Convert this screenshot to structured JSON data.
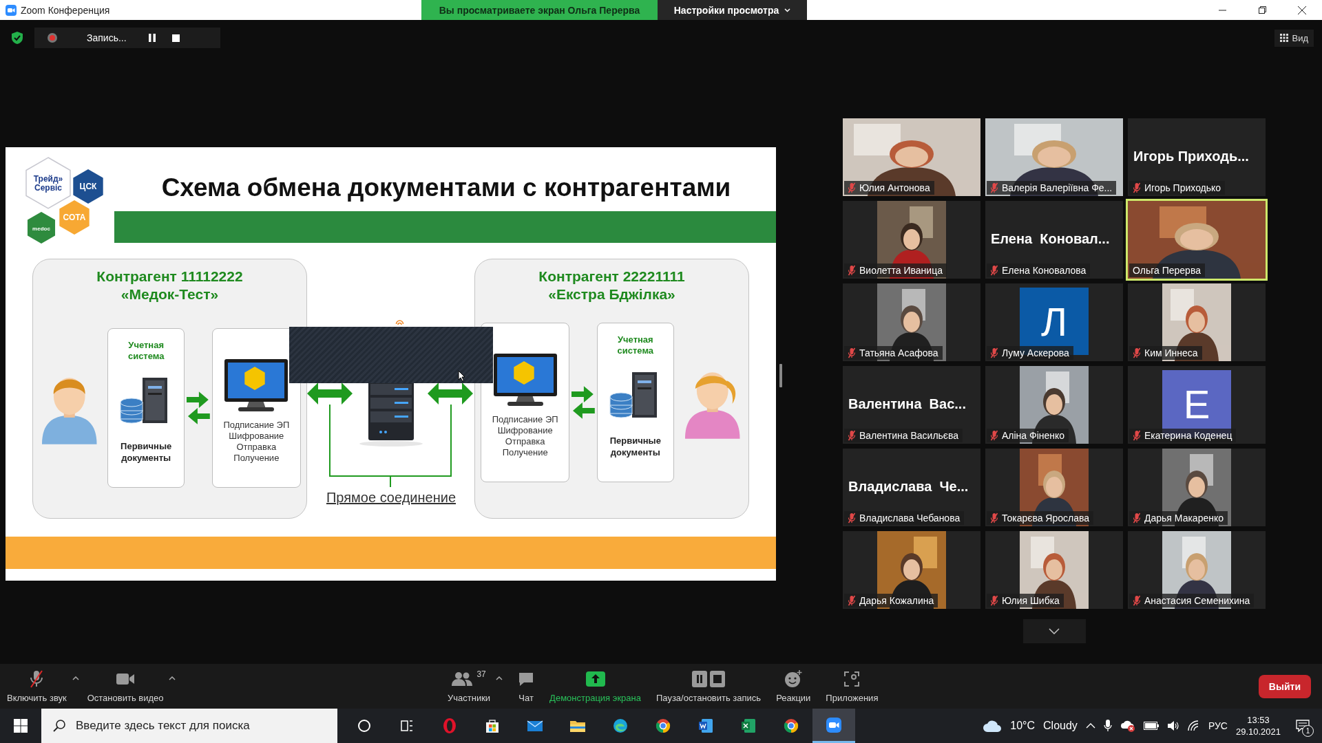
{
  "window": {
    "title": "Zoom Конференция"
  },
  "share_banner": {
    "text": "Вы просматриваете экран Ольга Перерва",
    "menu": "Настройки просмотра"
  },
  "recording": {
    "label": "Запись..."
  },
  "view_button": "Вид",
  "slide": {
    "title": "Схема обмена документами с контрагентами",
    "logos": [
      {
        "kind": "sota",
        "lines": [
          "СОТА"
        ]
      },
      {
        "kind": "trade",
        "lines": [
          "Трейд»",
          "Сервіс"
        ]
      },
      {
        "kind": "csk",
        "lines": [
          "ЦСК"
        ]
      },
      {
        "kind": "medoc",
        "lines": [
          "medoc"
        ]
      }
    ],
    "parties": [
      {
        "title": "Контрагент 11112222",
        "subtitle": "«Медок-Тест»",
        "system_label": "Учетная система",
        "docs_label": "Первичные документы",
        "operations": [
          "Подписание ЭП",
          "Шифрование",
          "Отправка",
          "Получение"
        ],
        "person": {
          "kind": "male"
        }
      },
      {
        "title": "Контрагент 22221111",
        "subtitle": "«Екстра Бджілка»",
        "system_label": "Учетная система",
        "docs_label": "Первичные документы",
        "operations": [
          "Подписание ЭП",
          "Шифрование",
          "Отправка",
          "Получение"
        ],
        "person": {
          "kind": "female"
        }
      }
    ],
    "connection_label": "Прямое соединение"
  },
  "participants": [
    {
      "name": "Юлия Антонова",
      "kind": "video",
      "muted": true,
      "active": false
    },
    {
      "name": "Валерія Валеріївна Фе...",
      "kind": "video",
      "muted": true,
      "active": false
    },
    {
      "name": "Игорь Приходько",
      "kind": "name",
      "display": "Игорь Приходь...",
      "muted": true,
      "active": false
    },
    {
      "name": "Виолетта Иваница",
      "muted": true,
      "active": false
    },
    {
      "name": "Елена Коновалова",
      "kind": "name",
      "display": "Елена  Коновал...",
      "muted": true,
      "active": false
    },
    {
      "name": "Ольга Перерва",
      "kind": "video",
      "muted": false,
      "active": true
    },
    {
      "name": "Татьяна Асафова",
      "muted": true,
      "active": false
    },
    {
      "name": "Луму Аскерова",
      "kind": "avatar",
      "letter": "Л",
      "color": "#0b5aa6",
      "muted": true,
      "active": false
    },
    {
      "name": "Ким Иннеса",
      "muted": true,
      "active": false
    },
    {
      "name": "Валентина Васильєва",
      "kind": "name",
      "display": "Валентина  Вас...",
      "muted": true,
      "active": false
    },
    {
      "name": "Аліна Фіненко",
      "muted": true,
      "active": false
    },
    {
      "name": "Екатерина Коденец",
      "kind": "avatar",
      "letter": "Е",
      "color": "#5b67c2",
      "muted": true,
      "active": false
    },
    {
      "name": "Владислава Чебанова",
      "kind": "name",
      "display": "Владислава  Че...",
      "muted": true,
      "active": false
    },
    {
      "name": "Токарєва Ярослава",
      "muted": true,
      "active": false
    },
    {
      "name": "Дарья Макаренко",
      "muted": true,
      "active": false
    },
    {
      "name": "Дарья Кожалина",
      "muted": true,
      "active": false
    },
    {
      "name": "Юлия Шибка",
      "muted": true,
      "active": false
    },
    {
      "name": "Анастасия Семенихина",
      "muted": true,
      "active": false
    }
  ],
  "toolbar": {
    "left": [
      {
        "kind": "mic",
        "label": "Включить звук",
        "caret": true
      },
      {
        "kind": "video",
        "label": "Остановить видео",
        "caret": true
      }
    ],
    "center": [
      {
        "kind": "participants",
        "label": "Участники",
        "count": "37",
        "caret": true
      },
      {
        "kind": "chat",
        "label": "Чат",
        "caret": false
      },
      {
        "kind": "share",
        "label": "Демонстрация экрана",
        "caret": false
      },
      {
        "kind": "record",
        "label": "Пауза/остановить запись",
        "caret": false
      },
      {
        "kind": "reactions",
        "label": "Реакции",
        "caret": false
      },
      {
        "kind": "apps",
        "label": "Приложения",
        "caret": false
      }
    ],
    "leave": "Выйти"
  },
  "taskbar": {
    "search_placeholder": "Введите здесь текст для поиска",
    "apps": [
      {
        "kind": "cortana",
        "active": false
      },
      {
        "kind": "taskview",
        "active": false
      },
      {
        "kind": "opera",
        "active": false
      },
      {
        "kind": "store",
        "active": false
      },
      {
        "kind": "mail",
        "active": false
      },
      {
        "kind": "explorer",
        "active": false
      },
      {
        "kind": "edge",
        "active": false
      },
      {
        "kind": "chrome",
        "active": false
      },
      {
        "kind": "word",
        "active": false
      },
      {
        "kind": "excel",
        "active": false
      },
      {
        "kind": "chrome",
        "active": false
      },
      {
        "kind": "zoom",
        "active": true
      }
    ],
    "temperature": "10°C",
    "weather": "Cloudy",
    "language": "РУС",
    "time": "13:53",
    "date": "29.10.2021",
    "notifications": "1"
  }
}
